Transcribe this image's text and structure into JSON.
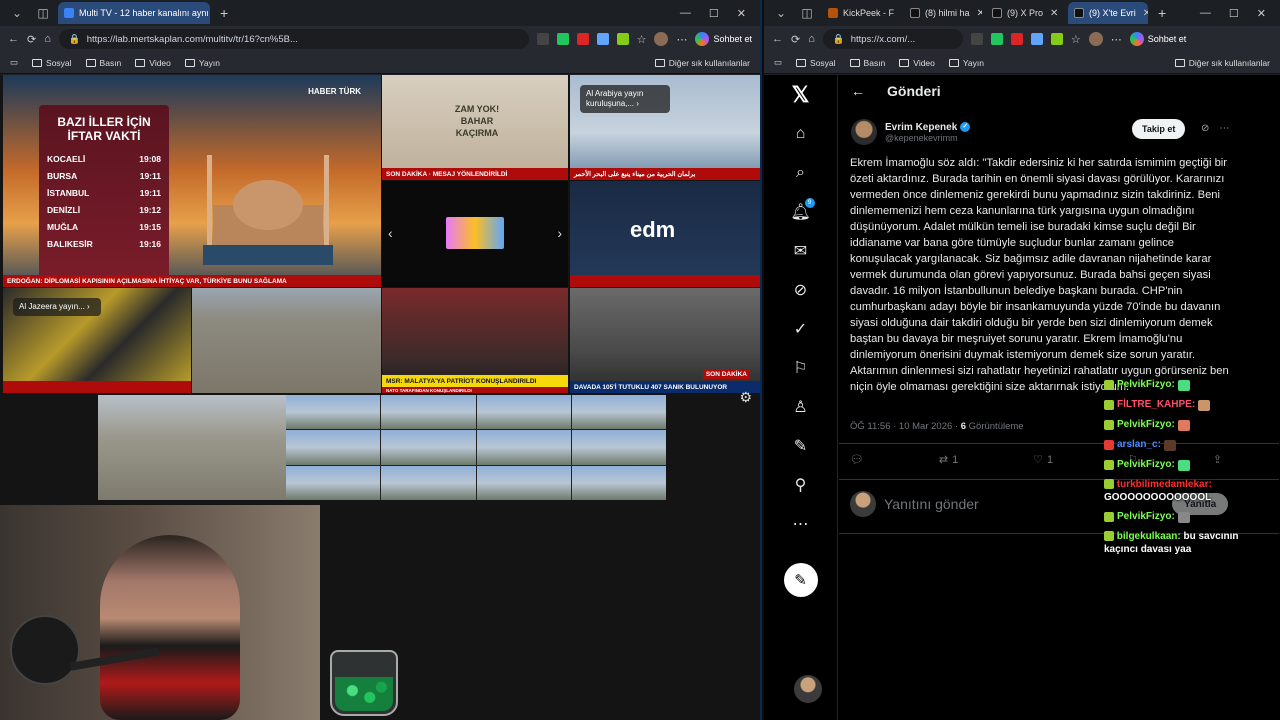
{
  "left_window": {
    "tabs": [
      {
        "label": "Multi TV - 12 haber kanalını aynı a",
        "active": true,
        "favicon_color": "#3b82f6"
      }
    ],
    "url": "https://lab.mertskaplan.com/multitv/tr/16?cn%5B...",
    "copilot_label": "Sohbet et",
    "bookmarks": [
      "Sosyal",
      "Basın",
      "Video",
      "Yayın"
    ],
    "other_favorites": "Diğer sık kullanılanlar"
  },
  "right_window": {
    "tabs": [
      {
        "label": "KickPeek - F",
        "active": false,
        "favicon_color": "#b45309"
      },
      {
        "label": "(8) hilmi ha",
        "active": false,
        "favicon_color": "#111111"
      },
      {
        "label": "(9) X Pro",
        "active": false,
        "favicon_color": "#111111"
      },
      {
        "label": "(9) X'te Evri",
        "active": true,
        "favicon_color": "#111111"
      }
    ],
    "url": "https://x.com/...",
    "copilot_label": "Sohbet et",
    "bookmarks": [
      "Sosyal",
      "Basın",
      "Video",
      "Yayın"
    ],
    "other_favorites": "Diğer sık kullanılanlar"
  },
  "tv": {
    "iftar": {
      "title": "BAZI İLLER İÇİN İFTAR VAKTİ",
      "rows": [
        {
          "city": "KOCAELİ",
          "time": "19:08"
        },
        {
          "city": "BURSA",
          "time": "19:11"
        },
        {
          "city": "İSTANBUL",
          "time": "19:11"
        },
        {
          "city": "DENİZLİ",
          "time": "19:12"
        },
        {
          "city": "MUĞLA",
          "time": "19:15"
        },
        {
          "city": "BALIKESİR",
          "time": "19:16"
        }
      ]
    },
    "haberturk_logo": "HABER TÜRK",
    "main_ticker": "ERDOĞAN: DİPLOMASİ KAPISININ AÇILMASINA İHTİYAÇ VAR, TÜRKİYE BUNU SAĞLAMA",
    "ad_tile_text": "ZAM YOK! BAHAR KAÇIRMA",
    "ad_ticker": "SON DAKİKA · MESAJ YÖNLENDİRİLDİ",
    "al_arabiya_label": "Al Arabiya yayın kuruluşuna,...",
    "arabic_ticker": "برلمان الحربية من ميناء ينبع على البحر الأحمر",
    "edm_logo": "edm",
    "al_jazeera_label": "Al Jazeera yayın...",
    "msr_ticker": "MSR: MALATYA'YA PATRİOT KONUŞLANDIRILDI",
    "davada_ticker": "DAVADA 105'İ TUTUKLU 407 SANIK BULUNUYOR",
    "son_dakika": "SON DAKİKA",
    "nato_subticker": "NATO TARAFINDAN KONUŞLANDIRILDI"
  },
  "x": {
    "header": "Gönderi",
    "author_name": "Evrim Kepenek",
    "author_handle": "@kepenekevrimm",
    "follow_label": "Takip et",
    "tweet_text": "Ekrem İmamoğlu söz aldı: \"Takdir edersiniz ki her satırda ismimim geçtiği bir özeti aktardınız. Burada tarihin en önemli siyasi davası görülüyor. Kararınızı vermeden önce dinlemeniz gerekirdi bunu yapmadınız sizin takdiriniz. Beni dinlememenizi hem ceza kanunlarına türk yargısına uygun olmadığını düşünüyorum. Adalet mülkün temeli ise buradaki kimse suçlu değil Bir iddianame var bana göre tümüyle suçludur bunlar zamanı gelince konuşulacak yargılanacak. Siz bağımsız adile davranan nijahetinde karar vermek durumunda olan görevi yapıyorsunuz. Burada bahsi geçen siyasi davadır. 16 milyon İstanbullunun belediye başkanı burada. CHP'nin cumhurbaşkanı adayı böyle bir insankamuyunda yüzde 70'inde bu davanın siyasi olduğuna dair takdiri olduğu bir yerde ben sizi dinlemiyorum demek baştan bu davaya bir meşruiyet sorunu yaratır. Ekrem İmamoğlu'nu dinlemiyorum önerisini duymak istemiyorum demek size sorun yaratır. Aktarımın dinlenmesi sizi rahatlatır heyetinizi rahatlatır uygun görürseniz ben niçin öyle olmaması gerektiğini size aktarırnak istiyorum.\"",
    "time": "ÖĞ 11:56 · 10 Mar 2026 ·",
    "views_count": "6",
    "views_label": "Görüntüleme",
    "retweets": "1",
    "likes": "1",
    "reply_placeholder": "Yanıtını gönder",
    "reply_button": "Yanıtla",
    "notif_count": "9"
  },
  "chat": [
    {
      "user": "PelvikFizyo:",
      "user_color": "#ff2d2d",
      "message": "",
      "badge": "green"
    },
    {
      "user": "FİLTRE_KAHPE:",
      "user_color": "#ff4fa3",
      "message": "",
      "badge": "green"
    },
    {
      "user": "PelvikFizyo:",
      "user_color": "#7cff4f",
      "message": "",
      "badge": "green"
    },
    {
      "user": "arslan_c:",
      "user_color": "#2f6bff",
      "message": "",
      "badge": "red"
    },
    {
      "user": "PelvikFizyo:",
      "user_color": "#7cff4f",
      "message": "",
      "badge": "green"
    },
    {
      "user": "turkbilimedamlekar:",
      "user_color": "#ff2d2d",
      "message": "GOOOOOOOOOOOOL",
      "badge": "green"
    },
    {
      "user": "PelvikFizyo:",
      "user_color": "#7cff4f",
      "message": "",
      "badge": "green"
    },
    {
      "user": "bilgekulkaan:",
      "user_color": "#7cff4f",
      "message": "bu savcının kaçıncı davası yaa",
      "badge": "green"
    }
  ]
}
